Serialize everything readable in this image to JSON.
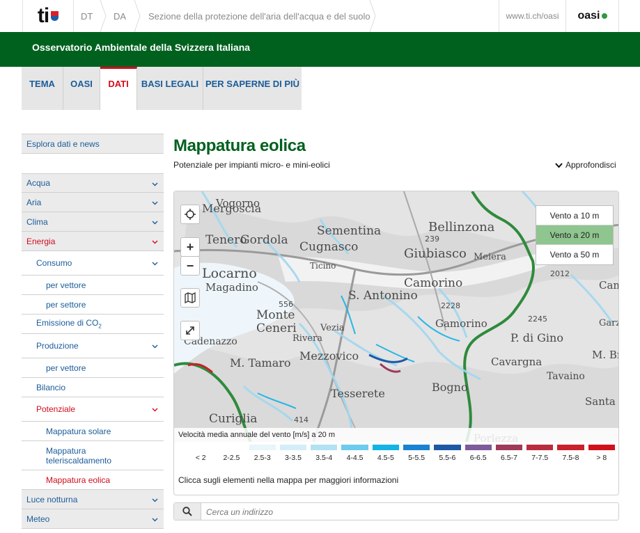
{
  "topbar": {
    "logo_text": "ti",
    "crumbs": [
      "DT",
      "DA",
      "Sezione della protezione dell'aria dell'acqua e del suolo"
    ],
    "site_link": "www.ti.ch/oasi",
    "oasi_logo": "oasi"
  },
  "header": {
    "title": "Osservatorio Ambientale della Svizzera Italiana"
  },
  "tabs": [
    {
      "label": "TEMA",
      "active": false
    },
    {
      "label": "OASI",
      "active": false
    },
    {
      "label": "DATI",
      "active": true
    },
    {
      "label": "BASI LEGALI",
      "active": false
    },
    {
      "label": "PER SAPERNE DI PIÙ",
      "active": false
    }
  ],
  "sidebar": {
    "top_item": "Esplora dati e news",
    "items": [
      {
        "label": "Acqua",
        "level": 1,
        "expandable": true,
        "active": false
      },
      {
        "label": "Aria",
        "level": 1,
        "expandable": true,
        "active": false
      },
      {
        "label": "Clima",
        "level": 1,
        "expandable": true,
        "active": false
      },
      {
        "label": "Energia",
        "level": 1,
        "expandable": true,
        "active": true
      },
      {
        "label": "Consumo",
        "level": 2,
        "expandable": true,
        "active": false
      },
      {
        "label": "per vettore",
        "level": 3,
        "expandable": false,
        "active": false
      },
      {
        "label": "per settore",
        "level": 3,
        "expandable": false,
        "active": false
      },
      {
        "label": "Emissione di CO",
        "sub": "2",
        "level": 2,
        "expandable": false,
        "active": false
      },
      {
        "label": "Produzione",
        "level": 2,
        "expandable": true,
        "active": false
      },
      {
        "label": "per vettore",
        "level": 3,
        "expandable": false,
        "active": false
      },
      {
        "label": "Bilancio",
        "level": 2,
        "expandable": false,
        "active": false
      },
      {
        "label": "Potenziale",
        "level": 2,
        "expandable": true,
        "active": true
      },
      {
        "label": "Mappatura solare",
        "level": 3,
        "expandable": false,
        "active": false
      },
      {
        "label": "Mappatura teleriscaldamento",
        "level": 3,
        "expandable": false,
        "active": false
      },
      {
        "label": "Mappatura eolica",
        "level": 3,
        "expandable": false,
        "active": true
      },
      {
        "label": "Luce notturna",
        "level": 1,
        "expandable": true,
        "active": false
      },
      {
        "label": "Meteo",
        "level": 1,
        "expandable": true,
        "active": false
      }
    ]
  },
  "main": {
    "title": "Mappatura eolica",
    "subtitle": "Potenziale per impianti micro- e mini-eolici",
    "approfondisci": "Approfondisci"
  },
  "map": {
    "layers": [
      {
        "label": "Vento a 10 m",
        "selected": false
      },
      {
        "label": "Vento a 20 m",
        "selected": true
      },
      {
        "label": "Vento a 50 m",
        "selected": false
      }
    ],
    "place_labels": [
      "Vogorno",
      "Mergoscia",
      "Tenero",
      "Gordola",
      "Sementina",
      "Bellinzona",
      "Cugnasco",
      "Giubiasco",
      "Locarno",
      "Magadino",
      "Ticino",
      "Camorino",
      "S. Antonino",
      "Monte",
      "Ceneri",
      "Cadenazzo",
      "Vezia",
      "P. di Gino",
      "Cavargna",
      "Tavaino",
      "M. Tamaro",
      "Mezzovico",
      "Bogno",
      "Tesserete",
      "Curiglia",
      "Santa M",
      "Porlezza",
      "Meiera",
      "Gamorino",
      "Garzo",
      "M. Breg",
      "Camoghè",
      "Rivera"
    ],
    "elevations": [
      "239",
      "2228",
      "2245",
      "2012",
      "556",
      "414"
    ],
    "caption": "Velocità media annuale del vento [m/s] a 20 m",
    "legend": [
      {
        "label": "< 2",
        "color": "#ffffff"
      },
      {
        "label": "2-2.5",
        "color": "#ffffff"
      },
      {
        "label": "2.5-3",
        "color": "#e8f5fb"
      },
      {
        "label": "3-3.5",
        "color": "#d3eef8"
      },
      {
        "label": "3.5-4",
        "color": "#b1e2f3"
      },
      {
        "label": "4-4.5",
        "color": "#6dcbee"
      },
      {
        "label": "4.5-5",
        "color": "#13b3e4"
      },
      {
        "label": "5-5.5",
        "color": "#1a82d1"
      },
      {
        "label": "5.5-6",
        "color": "#1d58a4"
      },
      {
        "label": "6-6.5",
        "color": "#7d5a9a"
      },
      {
        "label": "6.5-7",
        "color": "#9e3a5a"
      },
      {
        "label": "7-7.5",
        "color": "#b92c3e"
      },
      {
        "label": "7.5-8",
        "color": "#c9202b"
      },
      {
        "label": "> 8",
        "color": "#d2101a"
      }
    ],
    "info": "Clicca sugli elementi nella mappa per maggiori informazioni"
  },
  "search": {
    "placeholder": "Cerca un indirizzo"
  },
  "colors": {
    "brand_green": "#00611f",
    "accent_red": "#d10c1c",
    "link_blue": "#1a5c99"
  }
}
